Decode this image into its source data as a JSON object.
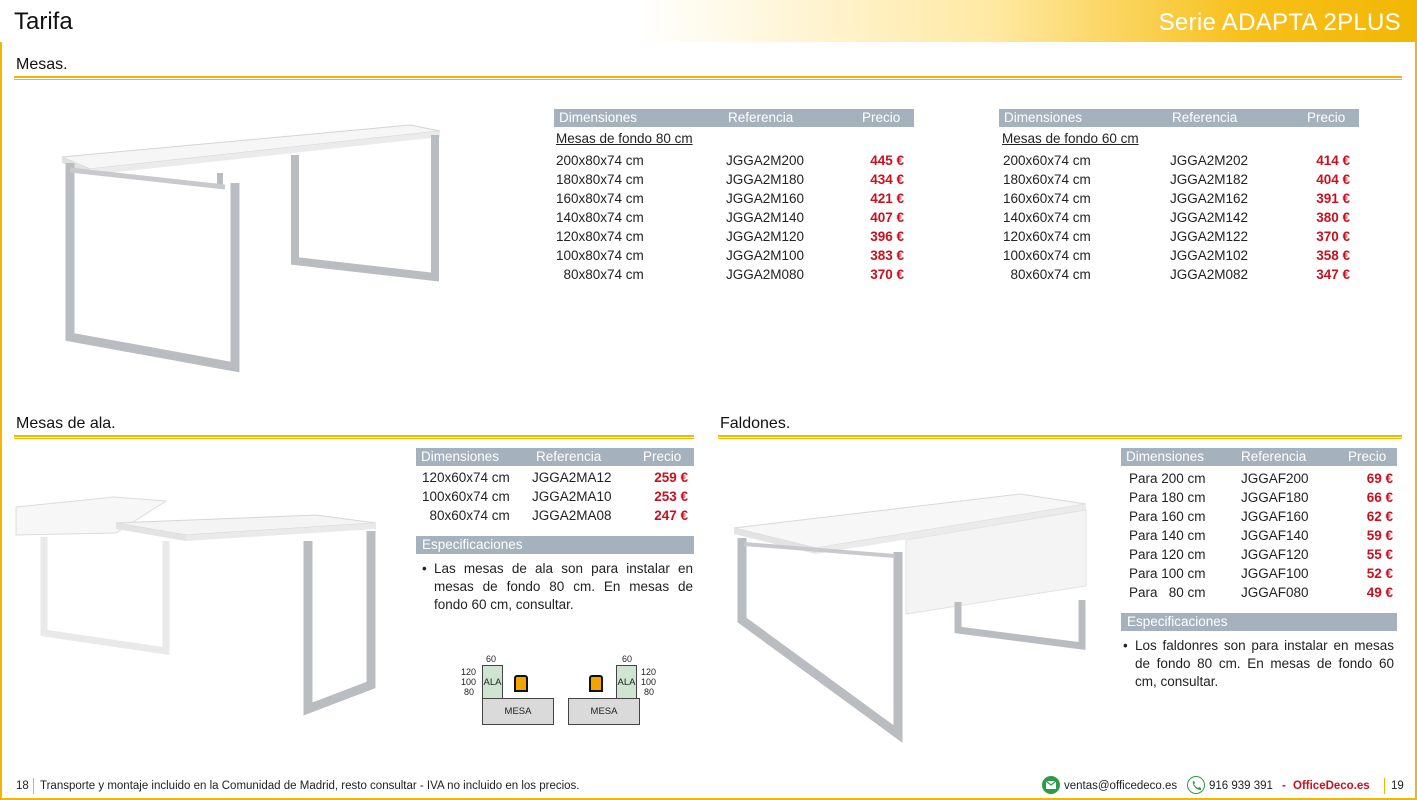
{
  "header": {
    "title": "Tarifa",
    "series": "Serie ADAPTA 2PLUS"
  },
  "sections": {
    "mesas": "Mesas.",
    "mesas_ala": "Mesas de ala.",
    "faldones": "Faldones."
  },
  "mesas80": {
    "headers": [
      "Dimensiones",
      "Referencia",
      "Precio"
    ],
    "subtitle": "Mesas de fondo 80 cm",
    "rows": [
      [
        "200x80x74 cm",
        "JGGA2M200",
        "445 €"
      ],
      [
        "180x80x74 cm",
        "JGGA2M180",
        "434 €"
      ],
      [
        "160x80x74 cm",
        "JGGA2M160",
        "421 €"
      ],
      [
        "140x80x74 cm",
        "JGGA2M140",
        "407 €"
      ],
      [
        "120x80x74 cm",
        "JGGA2M120",
        "396 €"
      ],
      [
        "100x80x74 cm",
        "JGGA2M100",
        "383 €"
      ],
      [
        "  80x80x74 cm",
        "JGGA2M080",
        "370 €"
      ]
    ]
  },
  "mesas60": {
    "headers": [
      "Dimensiones",
      "Referencia",
      "Precio"
    ],
    "subtitle": "Mesas de fondo 60 cm",
    "rows": [
      [
        "200x60x74 cm",
        "JGGA2M202",
        "414 €"
      ],
      [
        "180x60x74 cm",
        "JGGA2M182",
        "404 €"
      ],
      [
        "160x60x74 cm",
        "JGGA2M162",
        "391 €"
      ],
      [
        "140x60x74 cm",
        "JGGA2M142",
        "380 €"
      ],
      [
        "120x60x74 cm",
        "JGGA2M122",
        "370 €"
      ],
      [
        "100x60x74 cm",
        "JGGA2M102",
        "358 €"
      ],
      [
        "  80x60x74 cm",
        "JGGA2M082",
        "347 €"
      ]
    ]
  },
  "ala": {
    "headers": [
      "Dimensiones",
      "Referencia",
      "Precio"
    ],
    "rows": [
      [
        "120x60x74 cm",
        "JGGA2MA12",
        "259 €"
      ],
      [
        "100x60x74 cm",
        "JGGA2MA10",
        "253 €"
      ],
      [
        "  80x60x74 cm",
        "JGGA2MA08",
        "247 €"
      ]
    ],
    "spec_title": "Especificaciones",
    "spec_text": "Las mesas de ala son para instalar en mesas de fondo 80 cm. En mesas de fondo 60 cm, consultar."
  },
  "diagram": {
    "top": "60",
    "sizes": [
      "120",
      "100",
      "80"
    ],
    "ala": "ALA",
    "mesa": "MESA"
  },
  "faldones": {
    "headers": [
      "Dimensiones",
      "Referencia",
      "Precio"
    ],
    "rows": [
      [
        "Para 200 cm",
        "JGGAF200",
        "69 €"
      ],
      [
        "Para 180 cm",
        "JGGAF180",
        "66 €"
      ],
      [
        "Para 160 cm",
        "JGGAF160",
        "62 €"
      ],
      [
        "Para 140 cm",
        "JGGAF140",
        "59 €"
      ],
      [
        "Para 120 cm",
        "JGGAF120",
        "55 €"
      ],
      [
        "Para 100 cm",
        "JGGAF100",
        "52 €"
      ],
      [
        "Para   80 cm",
        "JGGAF080",
        "49 €"
      ]
    ],
    "spec_title": "Especificaciones",
    "spec_text": "Los faldonres son para instalar en mesas de fondo 80 cm. En mesas de fondo 60 cm, consultar."
  },
  "footer": {
    "page_left": "18",
    "note": "Transporte y montaje incluido en la Comunidad de Madrid, resto consultar - IVA no incluido en los precios.",
    "email": "ventas@officedeco.es",
    "phone": "916 939 391",
    "dash": "-",
    "brand": "OfficeDeco.es",
    "page_right": "19"
  },
  "colors": {
    "accent": "#f2b705",
    "header_bar": "#a5b1bd",
    "price": "#c8101e"
  },
  "icons": [
    "mail-icon",
    "phone-icon"
  ]
}
